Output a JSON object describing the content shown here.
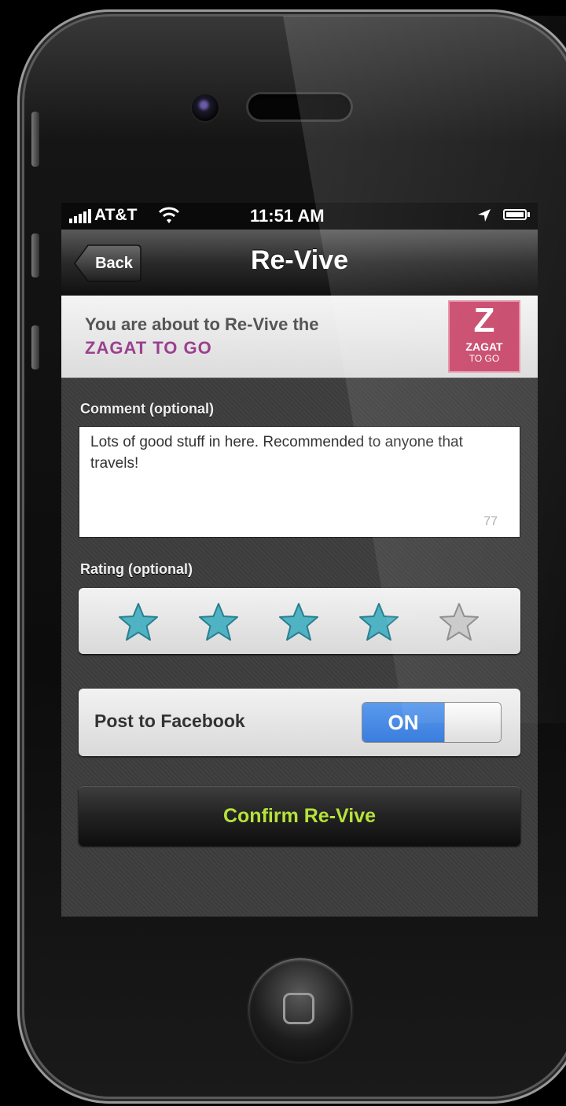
{
  "status_bar": {
    "carrier": "AT&T",
    "time": "11:51 AM",
    "signal_icon": "signal-bars-icon",
    "wifi_icon": "wifi-icon",
    "location_icon": "location-arrow-icon",
    "battery_icon": "battery-icon"
  },
  "nav": {
    "back_label": "Back",
    "title": "Re-Vive"
  },
  "banner": {
    "line1": "You are about to Re-Vive the",
    "line2": "ZAGAT TO GO",
    "logo": {
      "letter": "Z",
      "word": "ZAGAT",
      "sub": "TO GO"
    }
  },
  "comment": {
    "label": "Comment (optional)",
    "text": "Lots of good stuff in here. Recommended to anyone that travels!",
    "remaining": "77"
  },
  "rating": {
    "label": "Rating (optional)",
    "value": 4,
    "max": 5,
    "filled_color": "#4fb3c4",
    "empty_color": "#c8c8c8"
  },
  "facebook": {
    "label": "Post to Facebook",
    "toggle_label": "ON",
    "toggle_color": "#3a7ddc"
  },
  "confirm": {
    "label": "Confirm Re-Vive",
    "text_color": "#b6e23a"
  }
}
